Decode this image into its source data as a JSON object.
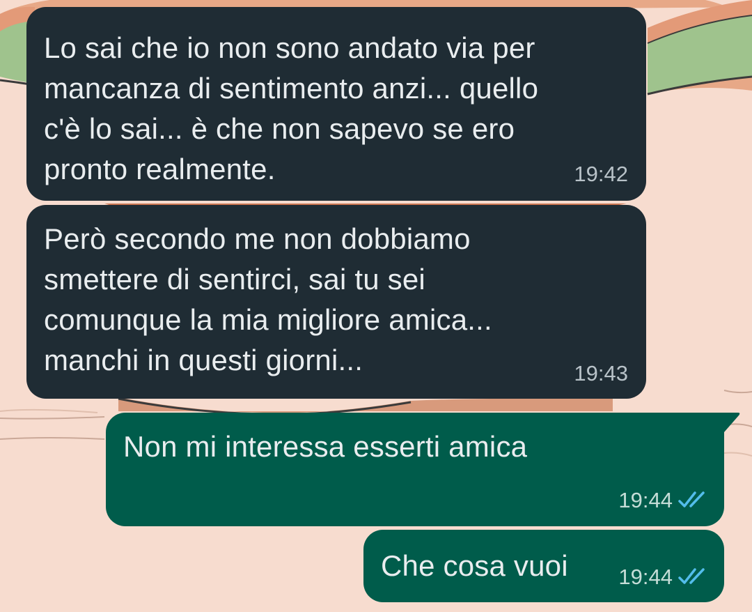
{
  "chat": {
    "messages": [
      {
        "direction": "incoming",
        "text": "Lo sai che io non sono andato via per\nmancanza di sentimento anzi... quello\nc'è lo sai... è che non sapevo se ero\npronto realmente.",
        "time": "19:42"
      },
      {
        "direction": "incoming",
        "text": "Però secondo me non dobbiamo\nsmettere di sentirci, sai tu sei\ncomunque la mia migliore amica...\nmanchi in questi giorni...",
        "time": "19:43"
      },
      {
        "direction": "outgoing",
        "text": "Non mi interessa esserti amica",
        "time": "19:44",
        "status_icon": "double-check-read-icon"
      },
      {
        "direction": "outgoing",
        "text": "Che cosa vuoi",
        "time": "19:44",
        "status_icon": "double-check-read-icon"
      }
    ]
  },
  "colors": {
    "incoming_bubble": "#1f2c34",
    "outgoing_bubble": "#005c4b",
    "read_ticks": "#53bdeb",
    "wallpaper": "#f7dccf"
  }
}
